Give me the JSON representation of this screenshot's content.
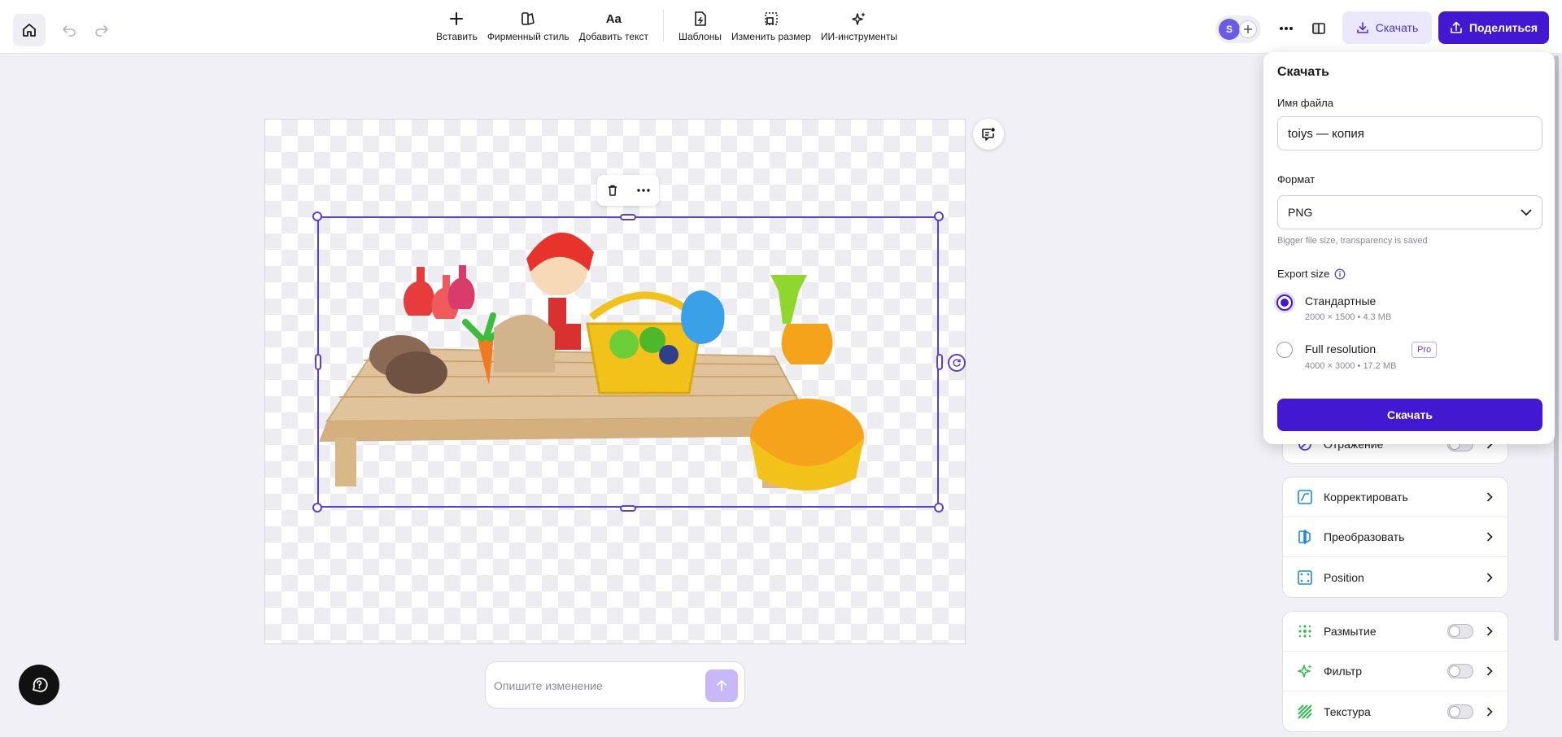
{
  "toolbar": {
    "tools": [
      {
        "label": "Вставить",
        "icon": "plus-icon"
      },
      {
        "label": "Фирменный стиль",
        "icon": "brand-style-icon"
      },
      {
        "label": "Добавить текст",
        "icon": "text-icon"
      },
      {
        "label": "Шаблоны",
        "icon": "templates-icon"
      },
      {
        "label": "Изменить размер",
        "icon": "resize-icon"
      },
      {
        "label": "ИИ-инструменты",
        "icon": "ai-sparkle-icon"
      }
    ],
    "avatar_initial": "S",
    "download_label": "Скачать",
    "share_label": "Поделиться"
  },
  "canvas": {
    "prompt_placeholder": "Опишите изменение"
  },
  "download_popover": {
    "title": "Скачать",
    "filename_label": "Имя файла",
    "filename_value": "toiys — копия",
    "format_label": "Формат",
    "format_value": "PNG",
    "format_hint": "Bigger file size, transparency is saved",
    "export_size_label": "Export size",
    "options": [
      {
        "title": "Стандартные",
        "subtitle": "2000 × 1500 • 4.3 MB",
        "selected": true
      },
      {
        "title": "Full resolution",
        "subtitle": "4000 × 3000 • 17.2 MB",
        "selected": false,
        "badge": "Pro"
      }
    ],
    "download_button": "Скачать"
  },
  "side_panel": {
    "partial_row": {
      "label": "Отражение"
    },
    "group_adjust": [
      {
        "label": "Корректировать",
        "icon": "adjust-icon"
      },
      {
        "label": "Преобразовать",
        "icon": "transform-icon"
      },
      {
        "label": "Position",
        "icon": "position-icon"
      }
    ],
    "group_effects": [
      {
        "label": "Размытие",
        "icon": "blur-icon",
        "enabled": false
      },
      {
        "label": "Фильтр",
        "icon": "filter-icon",
        "enabled": false
      },
      {
        "label": "Текстура",
        "icon": "texture-icon",
        "enabled": false
      }
    ]
  },
  "colors": {
    "accent": "#4318d1",
    "selection": "#5a3fd6"
  }
}
